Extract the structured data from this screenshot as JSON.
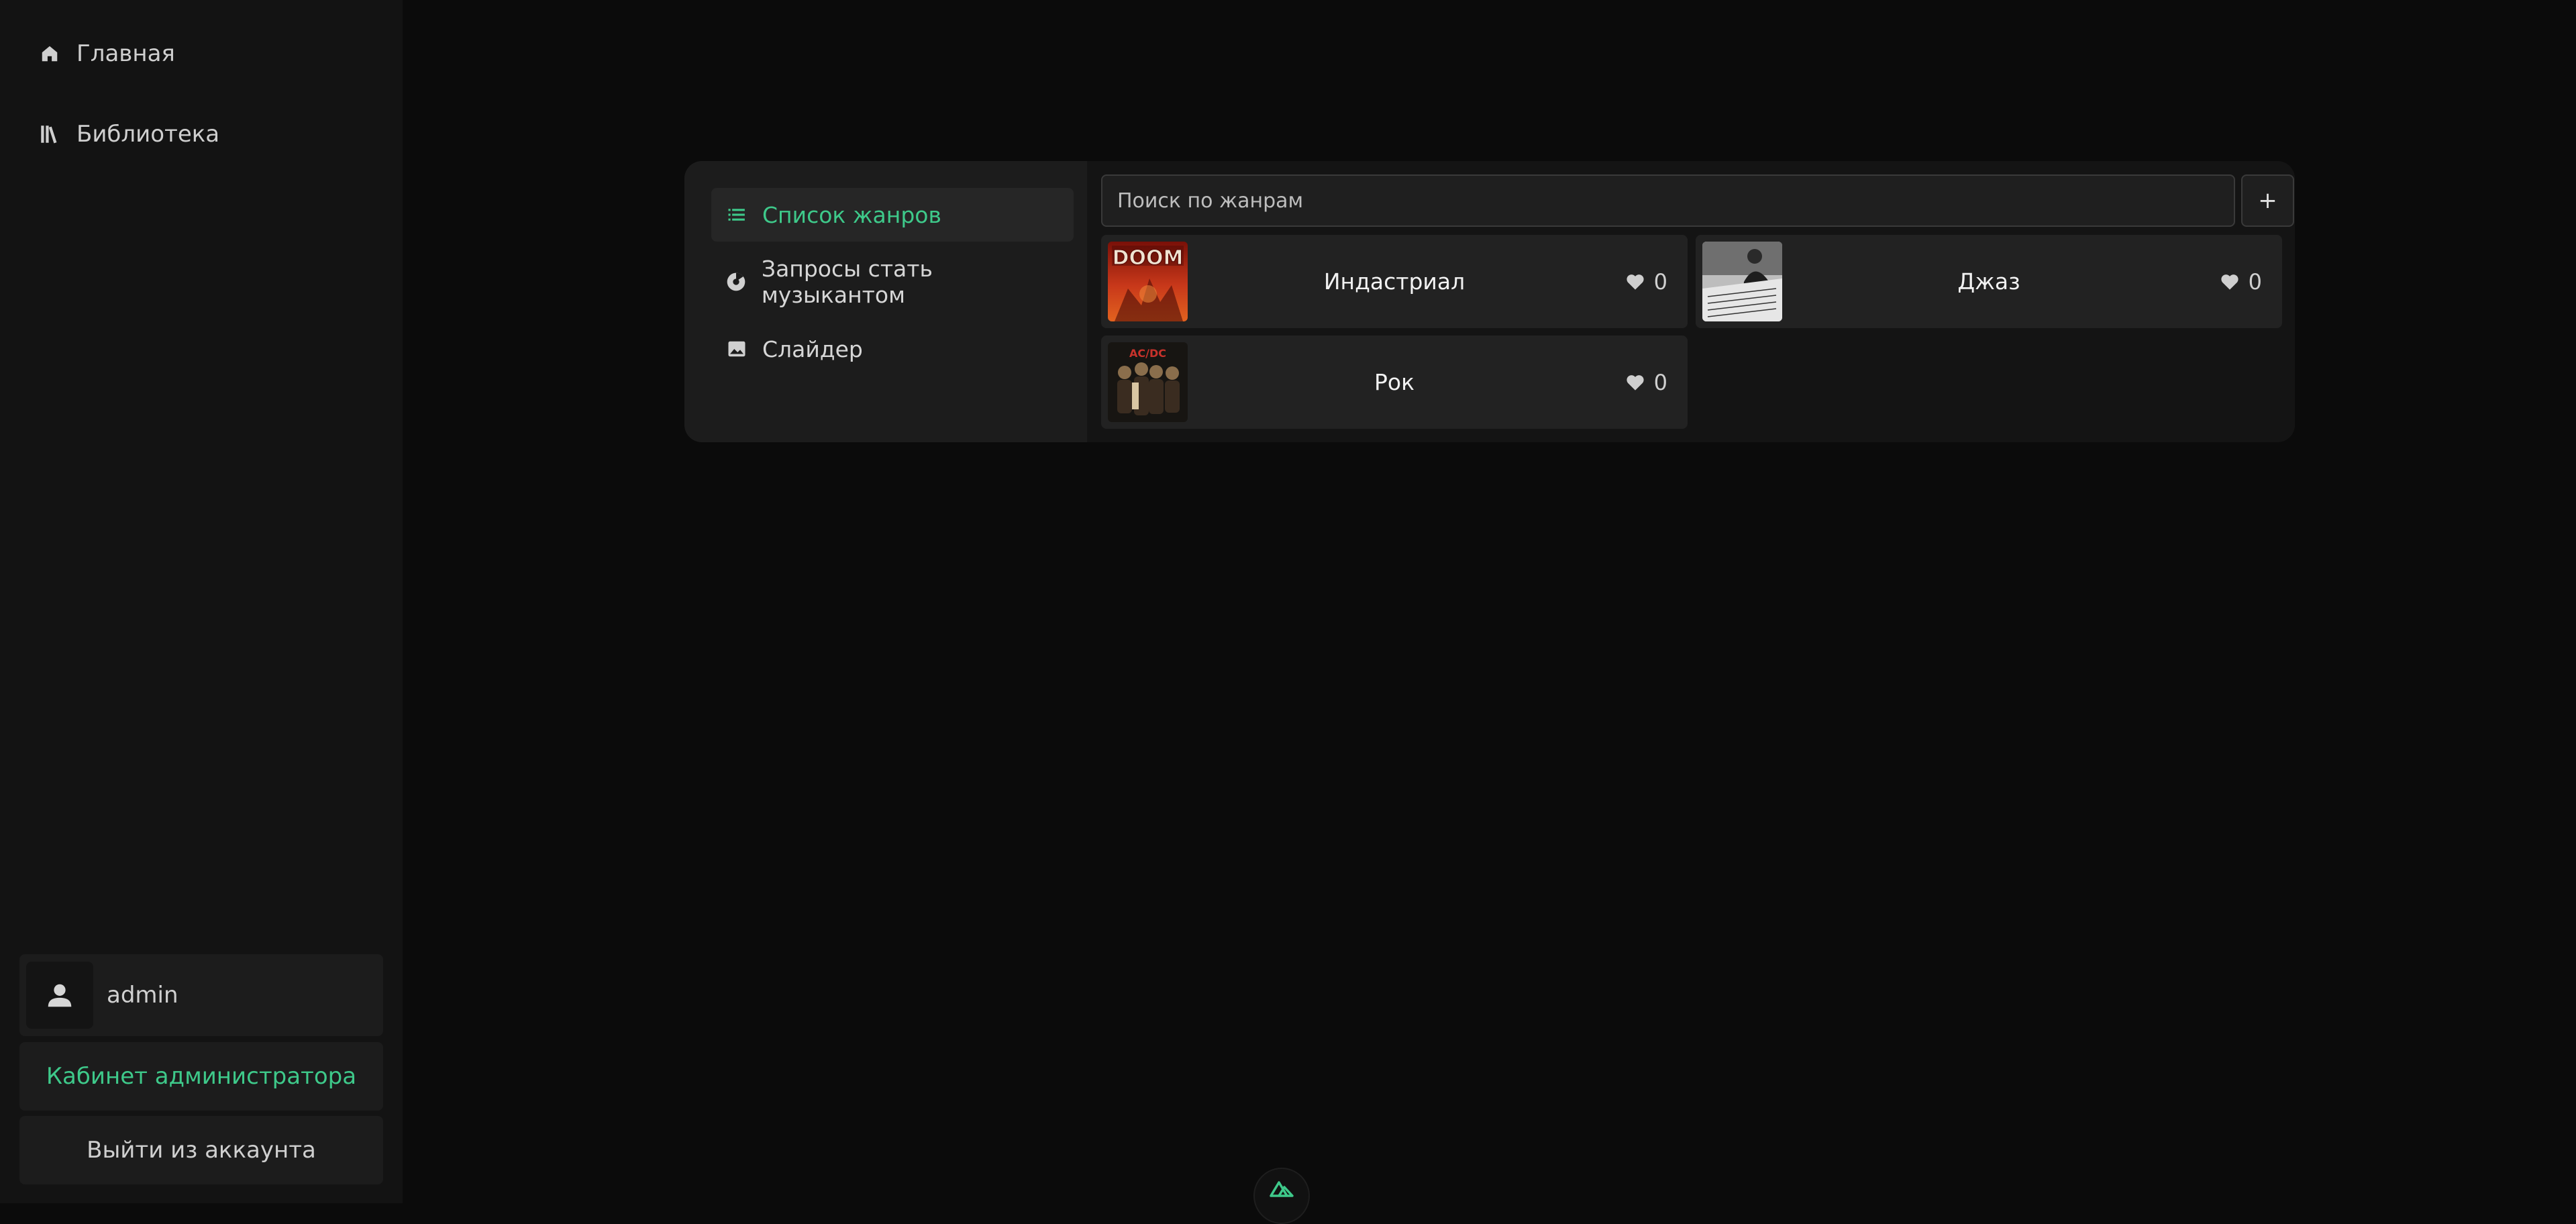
{
  "sidebar": {
    "nav": [
      {
        "label": "Главная",
        "icon": "home-icon"
      },
      {
        "label": "Библиотека",
        "icon": "library-icon"
      }
    ],
    "user": {
      "name": "admin",
      "icon": "user-icon"
    },
    "admin_button": "Кабинет администратора",
    "logout_button": "Выйти из аккаунта"
  },
  "panel": {
    "nav": [
      {
        "label": "Список жанров",
        "icon": "list-icon",
        "active": true
      },
      {
        "label": "Запросы стать музыкантом",
        "icon": "disc-icon",
        "active": false
      },
      {
        "label": "Слайдер",
        "icon": "image-icon",
        "active": false
      }
    ],
    "search": {
      "placeholder": "Поиск по жанрам",
      "value": ""
    },
    "add_button": "+",
    "genres": [
      {
        "name": "Индастриал",
        "likes": "0",
        "cover": "doom-cover"
      },
      {
        "name": "Джаз",
        "likes": "0",
        "cover": "jazz-cover"
      },
      {
        "name": "Рок",
        "likes": "0",
        "cover": "acdc-cover"
      }
    ]
  },
  "colors": {
    "accent": "#3ec98a",
    "background": "#0b0b0b",
    "sidebar": "#131313",
    "card": "#222222"
  }
}
